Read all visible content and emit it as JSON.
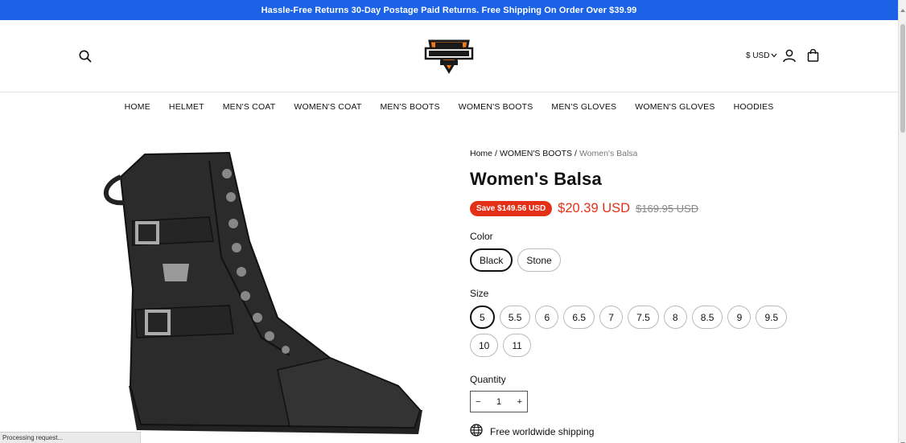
{
  "announcement": "Hassle-Free Returns 30-Day Postage Paid Returns. Free Shipping On Order Over $39.99",
  "header": {
    "logo_alt": "HARLEY-DAVIDSON MOTOR COMPANY",
    "currency": "$ USD"
  },
  "nav": [
    "HOME",
    "HELMET",
    "MEN'S COAT",
    "WOMEN'S COAT",
    "MEN'S BOOTS",
    "WOMEN'S BOOTS",
    "MEN'S GLOVES",
    "WOMEN'S GLOVES",
    "HOODIES"
  ],
  "product": {
    "breadcrumb": {
      "home": "Home",
      "sep": "/",
      "category": "WOMEN'S BOOTS",
      "current": "Women's Balsa"
    },
    "title": "Women's Balsa",
    "save_badge": "Save $149.56 USD",
    "price": "$20.39 USD",
    "compare_price": "$169.95 USD",
    "color_label": "Color",
    "colors": [
      "Black",
      "Stone"
    ],
    "selected_color": "Black",
    "size_label": "Size",
    "sizes": [
      "5",
      "5.5",
      "6",
      "6.5",
      "7",
      "7.5",
      "8",
      "8.5",
      "9",
      "9.5",
      "10",
      "11"
    ],
    "selected_size": "5",
    "quantity_label": "Quantity",
    "quantity": "1",
    "qty_minus": "−",
    "qty_plus": "+",
    "shipping_text": "Free worldwide shipping"
  },
  "status_bar": "Processing request...",
  "colors": {
    "announce_bg": "#1b62e6",
    "sale_red": "#e53018"
  }
}
